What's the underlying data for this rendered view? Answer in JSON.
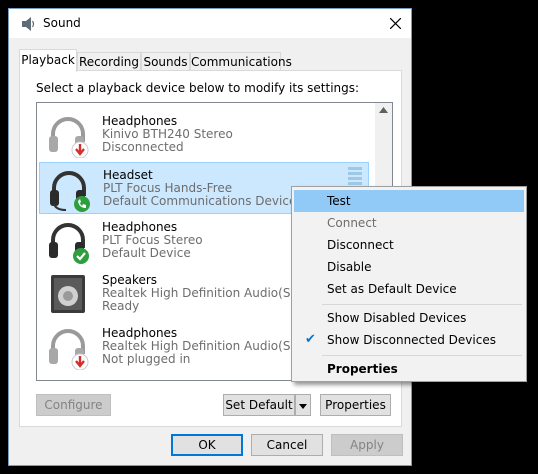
{
  "window": {
    "title": "Sound",
    "app_icon": "speaker-icon",
    "close_icon": "close-icon"
  },
  "tabs": [
    {
      "label": "Playback",
      "active": true
    },
    {
      "label": "Recording"
    },
    {
      "label": "Sounds"
    },
    {
      "label": "Communications"
    }
  ],
  "instruction": "Select a playback device below to modify its settings:",
  "devices": [
    {
      "name": "Headphones",
      "model": "Kinivo BTH240 Stereo",
      "status": "Disconnected",
      "icon": "headphones-icon",
      "badge": "red-down-arrow"
    },
    {
      "name": "Headset",
      "model": "PLT Focus Hands-Free",
      "status": "Default Communications Device",
      "icon": "headset-icon",
      "badge": "green-phone",
      "selected": true
    },
    {
      "name": "Headphones",
      "model": "PLT Focus Stereo",
      "status": "Default Device",
      "icon": "headphones-icon",
      "badge": "green-check"
    },
    {
      "name": "Speakers",
      "model": "Realtek High Definition Audio(SST)",
      "status": "Ready",
      "icon": "speaker-box-icon"
    },
    {
      "name": "Headphones",
      "model": "Realtek High Definition Audio(SST)",
      "status": "Not plugged in",
      "icon": "headphones-icon",
      "badge": "red-down-arrow"
    }
  ],
  "buttons": {
    "configure": "Configure",
    "set_default": "Set Default",
    "properties": "Properties",
    "ok": "OK",
    "cancel": "Cancel",
    "apply": "Apply"
  },
  "context_menu": {
    "test": "Test",
    "connect": "Connect",
    "disconnect": "Disconnect",
    "disable": "Disable",
    "set_default": "Set as Default Device",
    "show_disabled": "Show Disabled Devices",
    "show_disconnected": "Show Disconnected Devices",
    "properties": "Properties"
  },
  "colors": {
    "accent": "#0078d7",
    "selection": "#cce8ff",
    "menu_highlight": "#91c9f7",
    "error": "#d32f2f",
    "ok": "#2e9e3e"
  }
}
